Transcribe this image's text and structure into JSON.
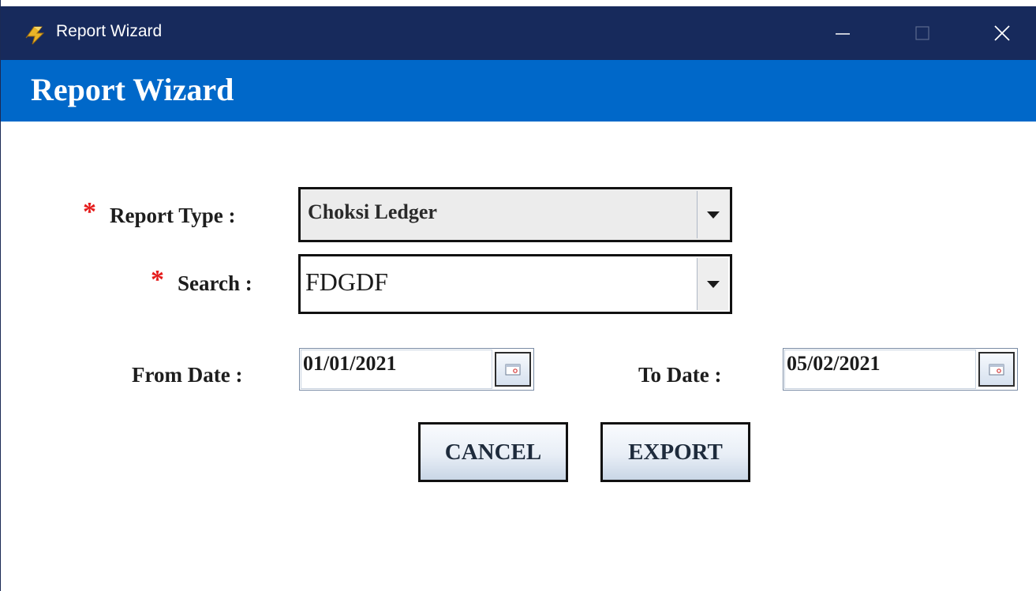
{
  "window": {
    "title": "Report Wizard",
    "controls": {
      "minimize": "minimize-icon",
      "maximize": "maximize-icon",
      "close": "close-icon"
    }
  },
  "banner": {
    "title": "Report Wizard"
  },
  "form": {
    "report_type": {
      "label": "Report Type :",
      "required_mark": "*",
      "value": "Choksi Ledger"
    },
    "search": {
      "label": "Search :",
      "required_mark": "*",
      "value": "FDGDF"
    },
    "from_date": {
      "label": "From Date :",
      "value": "01/01/2021"
    },
    "to_date": {
      "label": "To Date :",
      "value": "05/02/2021"
    }
  },
  "buttons": {
    "cancel": "CANCEL",
    "export": "EXPORT"
  },
  "colors": {
    "titlebar": "#172a5c",
    "banner": "#0068c9",
    "required": "#e51b1b"
  }
}
